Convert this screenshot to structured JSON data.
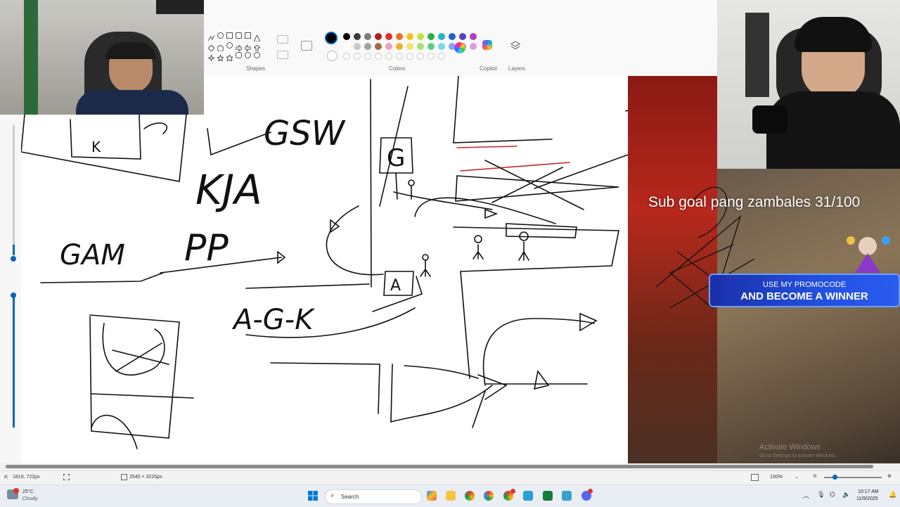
{
  "ribbon": {
    "shapes_label": "Shapes",
    "colors_label": "Colors",
    "copilot_label": "Copilot",
    "layers_label": "Layers",
    "palette_row1": [
      "#000000",
      "#3c3c3c",
      "#7a7a7a",
      "#b02020",
      "#e02c2c",
      "#f07020",
      "#f5c418",
      "#c8e038",
      "#28b048",
      "#20b4d0",
      "#2060c8",
      "#5a40c0",
      "#b040b8"
    ],
    "palette_row2": [
      "#ffffff",
      "#c8c8c8",
      "#a0a0a0",
      "#a06a48",
      "#f0a0b8",
      "#f0b030",
      "#f0e070",
      "#a8e070",
      "#58d088",
      "#78d8e8",
      "#80a8e8",
      "#9888d8",
      "#d8a0e0"
    ]
  },
  "statusbar": {
    "cursor_pos": "1819, 722px",
    "canvas_size": "2540 × 3225px",
    "zoom": "100%"
  },
  "taskbar": {
    "weather_temp": "25°C",
    "weather_desc": "Cloudy",
    "search_placeholder": "Search",
    "time": "10:17 AM",
    "date": "11/9/2025"
  },
  "overlay": {
    "sub_goal": "Sub goal pang zambales 31/100",
    "promo_line1": "USE MY PROMOCODE",
    "promo_line2": "AND BECOME A WINNER",
    "watermark_title": "Activate Windows",
    "watermark_sub": "Go to Settings to activate Windows."
  },
  "drawing_text": {
    "t1": "GSW",
    "t2": "KJA",
    "t3": "GAM",
    "t4": "PP",
    "t5": "A-G-K",
    "t6": "G",
    "t7": "A",
    "t8": "K"
  },
  "colors": {
    "accent": "#0067c0",
    "ink": "#111111",
    "red_stroke": "#d02020"
  }
}
